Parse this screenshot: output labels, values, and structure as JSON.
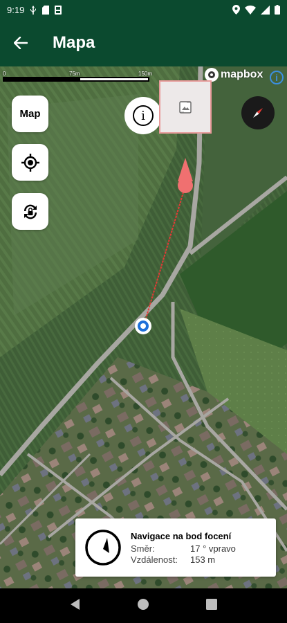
{
  "status_bar": {
    "time": "9:19",
    "icons": [
      "usb-icon",
      "sd-card-icon",
      "save-icon",
      "location-icon",
      "wifi-icon",
      "signal-icon",
      "battery-icon"
    ]
  },
  "app_bar": {
    "back_icon": "arrow-left-icon",
    "title": "Mapa"
  },
  "map": {
    "scale": {
      "label_start": "0",
      "label_mid": "75m",
      "label_end": "150m"
    },
    "attribution": {
      "logo_text": "mapbox",
      "info_label": "i"
    },
    "controls": {
      "map_button_label": "Map",
      "locate_icon": "crosshair-icon",
      "sync_icon": "sync-lock-icon",
      "info_label": "i",
      "photo_icon": "image-icon",
      "compass_icon": "compass-icon"
    },
    "colors": {
      "route_line": "#e53935",
      "target_marker": "#f07070",
      "user_location": "#1e6fd9",
      "header": "#0b4a2f"
    }
  },
  "navigation_card": {
    "title": "Navigace na bod focení",
    "direction_label": "Směr:",
    "direction_value": "17 ° vpravo",
    "distance_label": "Vzdálenost:",
    "distance_value": "153 m",
    "icon": "compass-arrow-icon"
  },
  "system_nav": {
    "back_icon": "back-triangle-icon",
    "home_icon": "home-circle-icon",
    "recents_icon": "recents-square-icon"
  }
}
